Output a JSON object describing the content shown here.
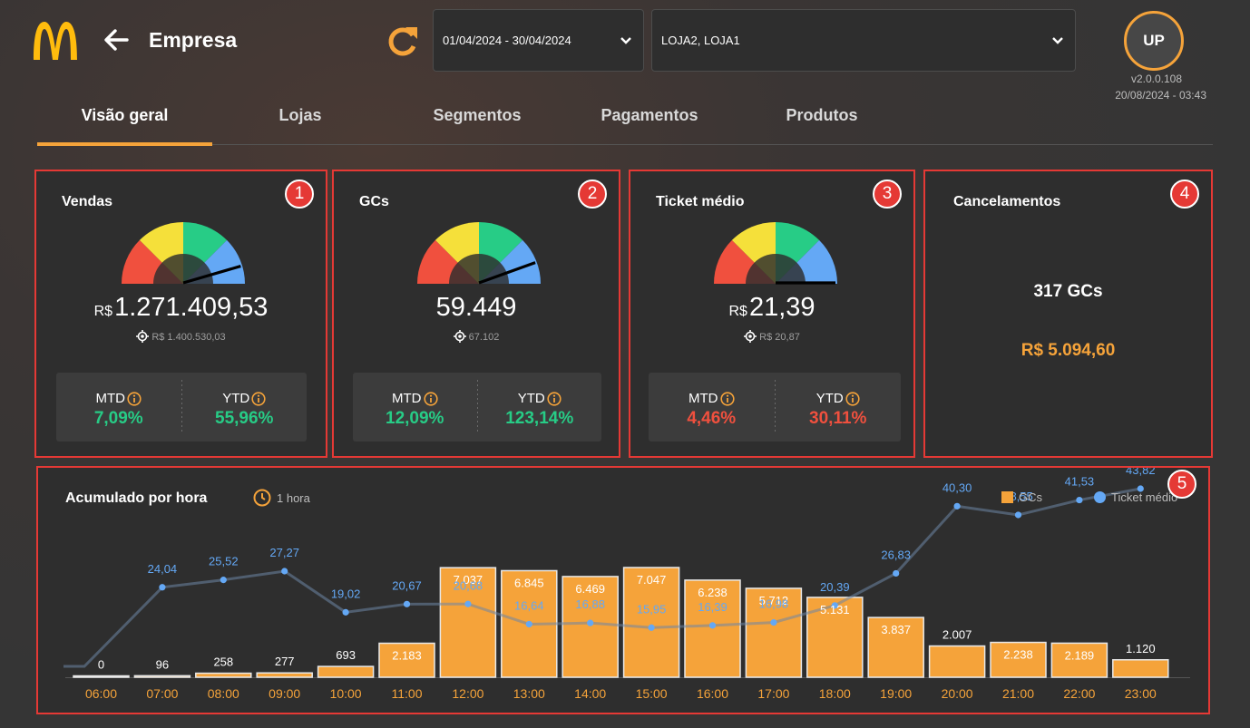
{
  "header": {
    "title": "Empresa",
    "date_range": "01/04/2024 - 30/04/2024",
    "stores": "LOJA2, LOJA1",
    "avatar": "UP",
    "version": "v2.0.0.108",
    "updated": "20/08/2024 - 03:43",
    "brand_color": "#f5a33a"
  },
  "tabs": [
    {
      "label": "Visão geral",
      "active": true
    },
    {
      "label": "Lojas"
    },
    {
      "label": "Segmentos"
    },
    {
      "label": "Pagamentos"
    },
    {
      "label": "Produtos"
    }
  ],
  "cards": {
    "vendas": {
      "badge": "1",
      "title": "Vendas",
      "currency": "R$",
      "value": "1.271.409,53",
      "target": "R$ 1.400.530,03",
      "mtd_label": "MTD",
      "mtd": "7,09%",
      "ytd_label": "YTD",
      "ytd": "55,96%"
    },
    "gcs": {
      "badge": "2",
      "title": "GCs",
      "value": "59.449",
      "target": "67.102",
      "mtd_label": "MTD",
      "mtd": "12,09%",
      "ytd_label": "YTD",
      "ytd": "123,14%"
    },
    "ticket": {
      "badge": "3",
      "title": "Ticket médio",
      "currency": "R$",
      "value": "21,39",
      "target": "R$ 20,87",
      "mtd_label": "MTD",
      "mtd": "4,46%",
      "ytd_label": "YTD",
      "ytd": "30,11%"
    },
    "cancelamentos": {
      "badge": "4",
      "title": "Cancelamentos",
      "gcs": "317 GCs",
      "value": "R$ 5.094,60"
    }
  },
  "chart_section": {
    "badge": "5",
    "title": "Acumulado por hora",
    "interval": "1 hora",
    "legend_gcs": "GCs",
    "legend_ticket": "Ticket médio"
  },
  "chart_data": {
    "type": "bar",
    "categories": [
      "06:00",
      "07:00",
      "08:00",
      "09:00",
      "10:00",
      "11:00",
      "12:00",
      "13:00",
      "14:00",
      "15:00",
      "16:00",
      "17:00",
      "18:00",
      "19:00",
      "20:00",
      "21:00",
      "22:00",
      "23:00"
    ],
    "series": [
      {
        "name": "GCs",
        "type": "bar",
        "color": "#f5a33a",
        "values": [
          0,
          96,
          258,
          277,
          693,
          2183,
          7037,
          6845,
          6469,
          7047,
          6238,
          5712,
          5131,
          3837,
          2007,
          2238,
          2189,
          1120
        ],
        "labels": [
          "0",
          "96",
          "258",
          "277",
          "693",
          "2.183",
          "7.037",
          "6.845",
          "6.469",
          "7.047",
          "6.238",
          "5.712",
          "5.131",
          "3.837",
          "2.007",
          "2.238",
          "2.189",
          "1.120"
        ]
      },
      {
        "name": "Ticket médio",
        "type": "line",
        "color": "#64a8f5",
        "values": [
          0,
          24.04,
          25.52,
          27.27,
          19.02,
          20.67,
          20.68,
          16.64,
          16.88,
          15.95,
          16.39,
          16.98,
          20.39,
          26.83,
          40.3,
          38.55,
          41.53,
          43.82
        ],
        "labels": [
          "",
          "24,04",
          "25,52",
          "27,27",
          "19,02",
          "20,67",
          "20,68",
          "16,64",
          "16,88",
          "15,95",
          "16,39",
          "16,98",
          "20,39",
          "26,83",
          "40,30",
          "38,55",
          "41,53",
          "43,82"
        ]
      }
    ],
    "gauges": [
      {
        "card": "vendas",
        "ratio": 0.91
      },
      {
        "card": "gcs",
        "ratio": 0.89
      },
      {
        "card": "ticket",
        "ratio": 1.0
      }
    ]
  }
}
